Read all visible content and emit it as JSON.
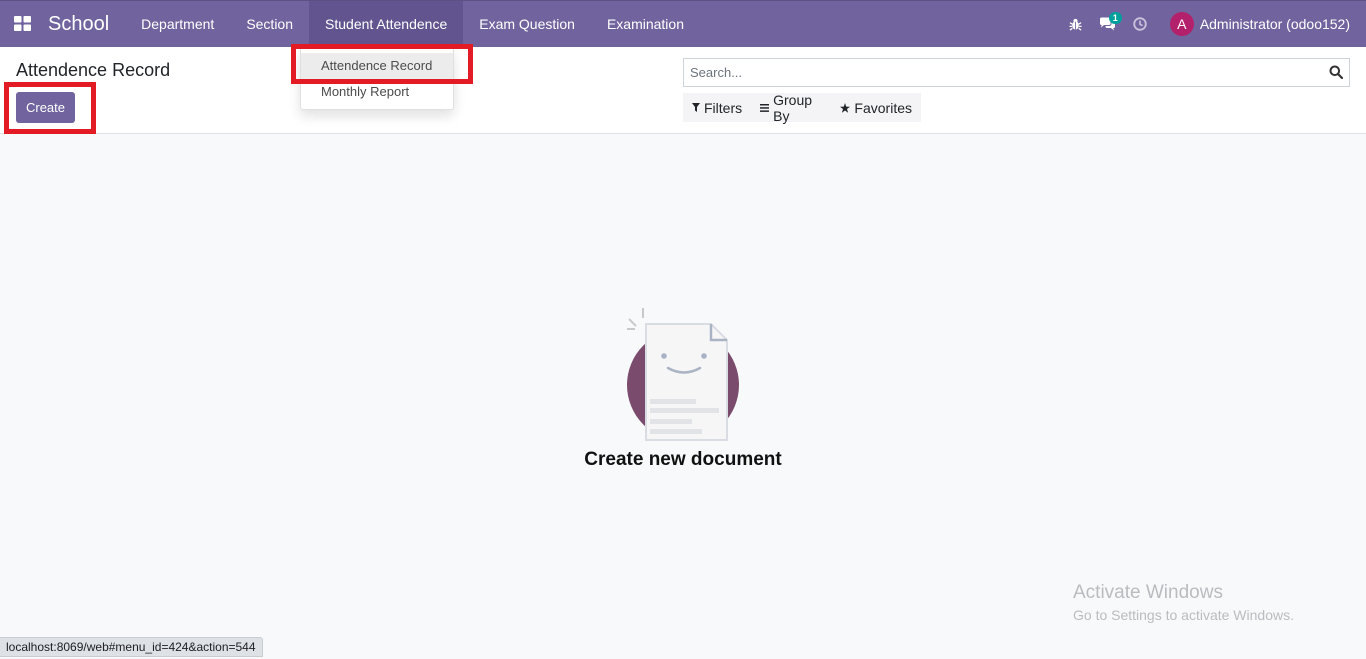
{
  "navbar": {
    "brand": "School",
    "menu": [
      {
        "label": "Department"
      },
      {
        "label": "Section"
      },
      {
        "label": "Student Attendence"
      },
      {
        "label": "Exam Question"
      },
      {
        "label": "Examination"
      }
    ],
    "messages_badge": "1",
    "user": {
      "initial": "A",
      "name": "Administrator (odoo152)",
      "avatar_color": "#b3206c"
    },
    "icons": [
      "apps-grid-icon",
      "bug-icon",
      "chat-icon",
      "clock-icon"
    ],
    "color": "#71639e"
  },
  "dropdown": {
    "items": [
      {
        "label": "Attendence Record"
      },
      {
        "label": "Monthly Report"
      }
    ]
  },
  "control_panel": {
    "title": "Attendence Record",
    "create_label": "Create",
    "search_placeholder": "Search...",
    "filters_label": "Filters",
    "group_by_label": "Group By",
    "favorites_label": "Favorites"
  },
  "empty_state": {
    "title": "Create new document"
  },
  "watermark": {
    "title": "Activate Windows",
    "subtitle": "Go to Settings to activate Windows."
  },
  "status_bar": {
    "url": "localhost:8069/web#menu_id=424&action=544"
  },
  "annotations": {
    "highlight_color": "#e21b24"
  }
}
